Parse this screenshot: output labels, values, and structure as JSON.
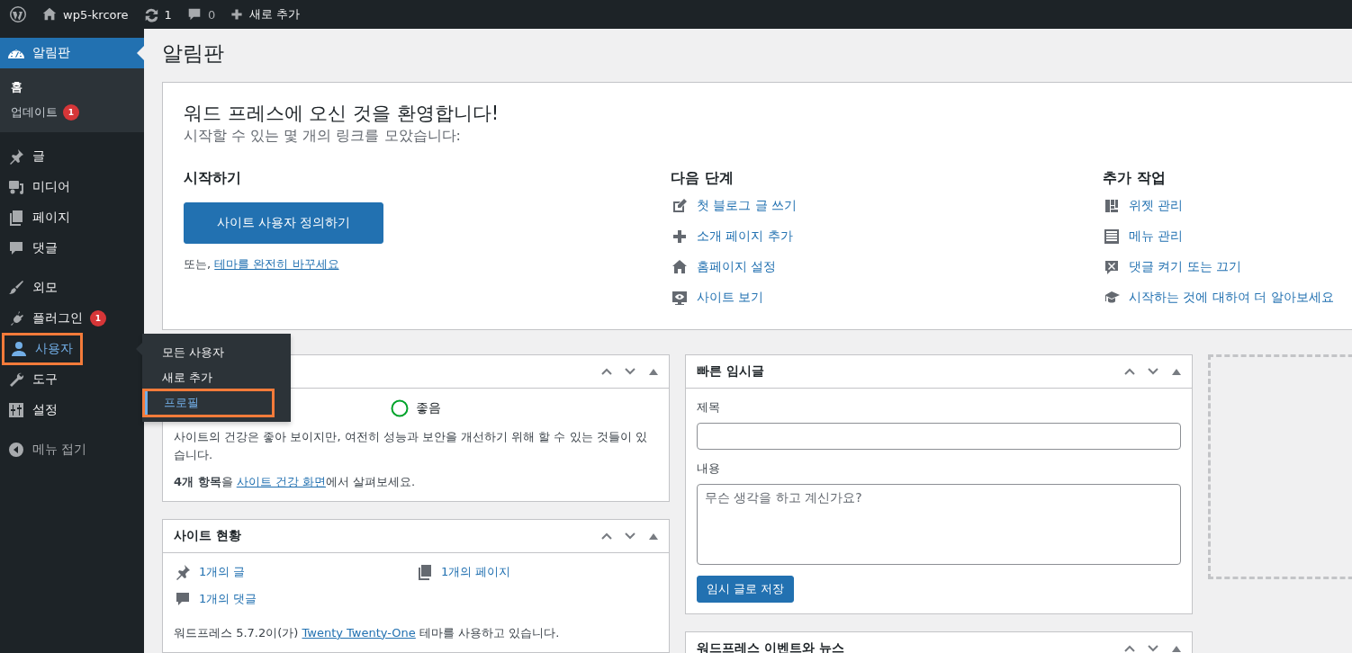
{
  "admin_bar": {
    "site_name": "wp5-krcore",
    "updates_count": "1",
    "comments_count": "0",
    "new_label": "새로 추가"
  },
  "sidebar": {
    "groups": [
      {
        "items": [
          {
            "label": "알림판",
            "selected": true,
            "hovered": false,
            "highlighted": false,
            "submenu": [
              {
                "label": "홈",
                "selected": true
              },
              {
                "label": "업데이트",
                "selected": false,
                "badge": "1"
              }
            ]
          }
        ]
      },
      {
        "items": [
          {
            "label": "글",
            "selected": false,
            "hovered": false,
            "highlighted": false
          },
          {
            "label": "미디어",
            "selected": false,
            "hovered": false,
            "highlighted": false
          },
          {
            "label": "페이지",
            "selected": false,
            "hovered": false,
            "highlighted": false
          },
          {
            "label": "댓글",
            "selected": false,
            "hovered": false,
            "highlighted": false
          }
        ]
      },
      {
        "items": [
          {
            "label": "외모",
            "selected": false,
            "hovered": false,
            "highlighted": false
          },
          {
            "label": "플러그인",
            "selected": false,
            "hovered": false,
            "highlighted": false,
            "badge": "1"
          },
          {
            "label": "사용자",
            "selected": false,
            "hovered": true,
            "highlighted": true,
            "flyout": [
              {
                "label": "모든 사용자",
                "selected": false,
                "highlighted": false
              },
              {
                "label": "새로 추가",
                "selected": false,
                "highlighted": false
              },
              {
                "label": "프로필",
                "selected": true,
                "highlighted": true
              }
            ]
          },
          {
            "label": "도구",
            "selected": false,
            "hovered": false,
            "highlighted": false
          },
          {
            "label": "설정",
            "selected": false,
            "hovered": false,
            "highlighted": false
          }
        ]
      }
    ],
    "collapse_label": "메뉴 접기"
  },
  "page_title": "알림판",
  "welcome": {
    "title": "워드 프레스에 오신 것을 환영합니다!",
    "subtitle": "시작할 수 있는 몇 개의 링크를 모았습니다:",
    "start": {
      "heading": "시작하기",
      "button": "사이트 사용자 정의하기",
      "or_text": "또는, ",
      "or_link": "테마를 완전히 바꾸세요"
    },
    "next_steps": {
      "heading": "다음 단계",
      "links": [
        "첫 블로그 글 쓰기",
        "소개 페이지 추가",
        "홈페이지 설정",
        "사이트 보기"
      ]
    },
    "more_actions": {
      "heading": "추가 작업",
      "links": [
        "위젯 관리",
        "메뉴 관리",
        "댓글 켜기 또는 끄기",
        "시작하는 것에 대하여 더 알아보세요"
      ]
    }
  },
  "health_widget": {
    "status_label": "좋음",
    "description": "사이트의 건강은 좋아 보이지만, 여전히 성능과 보안을 개선하기 위해 할 수 있는 것들이 있습니다.",
    "summary_before": "**4개 항목**을 ",
    "summary_link": "사이트 건강 화면",
    "summary_after": "에서 살펴보세요."
  },
  "glance_widget": {
    "title": "사이트 현황",
    "items": [
      "1개의 글",
      "1개의 페이지",
      "1개의 댓글"
    ],
    "version_before": "워드프레스 5.7.2이(가) ",
    "version_link": "Twenty Twenty-One",
    "version_after": " 테마를 사용하고 있습니다."
  },
  "quick_draft": {
    "title": "빠른 임시글",
    "title_label": "제목",
    "content_label": "내용",
    "content_placeholder": "무슨 생각을 하고 계신가요?",
    "button": "임시 글로 저장"
  },
  "news_widget": {
    "title": "워드프레스 이벤트와 뉴스"
  }
}
